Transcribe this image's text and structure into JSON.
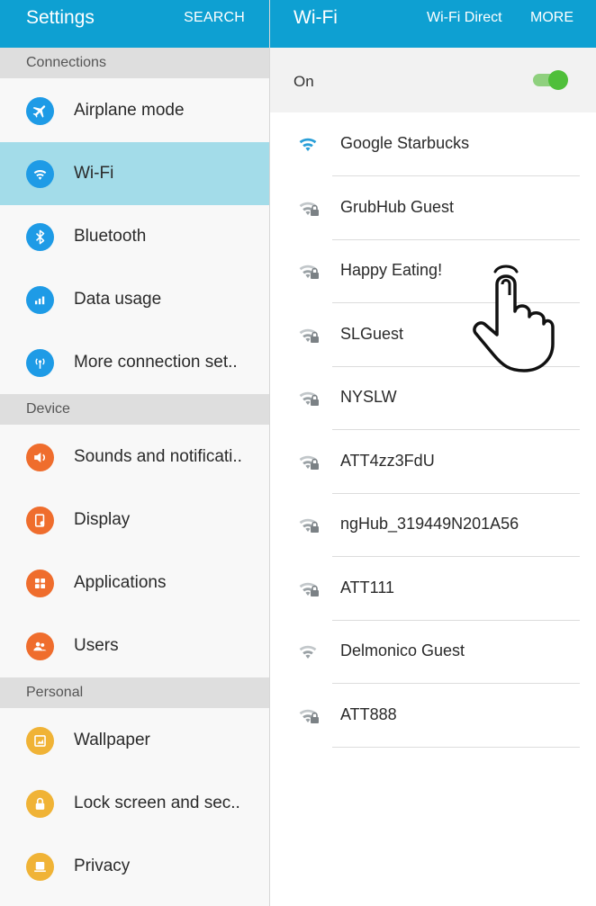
{
  "settings_pane": {
    "title": "Settings",
    "search_label": "SEARCH",
    "sections": [
      {
        "label": "Connections"
      },
      {
        "label": "Device"
      },
      {
        "label": "Personal"
      }
    ],
    "items": [
      {
        "label": "Airplane mode",
        "icon": "airplane-icon"
      },
      {
        "label": "Wi-Fi",
        "icon": "wifi-icon",
        "selected": true
      },
      {
        "label": "Bluetooth",
        "icon": "bluetooth-icon"
      },
      {
        "label": "Data usage",
        "icon": "bar-chart-icon"
      },
      {
        "label": "More connection set..",
        "icon": "antenna-icon"
      },
      {
        "label": "Sounds and notificati..",
        "icon": "speaker-icon"
      },
      {
        "label": "Display",
        "icon": "display-icon"
      },
      {
        "label": "Applications",
        "icon": "grid-icon"
      },
      {
        "label": "Users",
        "icon": "users-icon"
      },
      {
        "label": "Wallpaper",
        "icon": "image-icon"
      },
      {
        "label": "Lock screen and sec..",
        "icon": "lock-icon"
      },
      {
        "label": "Privacy",
        "icon": "privacy-icon"
      }
    ]
  },
  "wifi_pane": {
    "title": "Wi-Fi",
    "wifi_direct_label": "Wi-Fi Direct",
    "more_label": "MORE",
    "toggle_label": "On",
    "toggle_on": true,
    "networks": [
      {
        "name": "Google Starbucks",
        "secured": false,
        "connected": true
      },
      {
        "name": "GrubHub Guest",
        "secured": true
      },
      {
        "name": "Happy Eating!",
        "secured": true
      },
      {
        "name": "SLGuest",
        "secured": true
      },
      {
        "name": "NYSLW",
        "secured": true
      },
      {
        "name": "ATT4zz3FdU",
        "secured": true
      },
      {
        "name": "ngHub_319449N201A56",
        "secured": true
      },
      {
        "name": "ATT111",
        "secured": true
      },
      {
        "name": "Delmonico Guest",
        "secured": false
      },
      {
        "name": "ATT888",
        "secured": true
      }
    ]
  },
  "colors": {
    "header": "#0ea0d2",
    "selected_row": "#a3dce9",
    "toggle_on": "#4fbf3a",
    "icon_blue": "#1e9be6",
    "icon_orange": "#ef6d2d",
    "icon_yellow": "#f0b336"
  }
}
